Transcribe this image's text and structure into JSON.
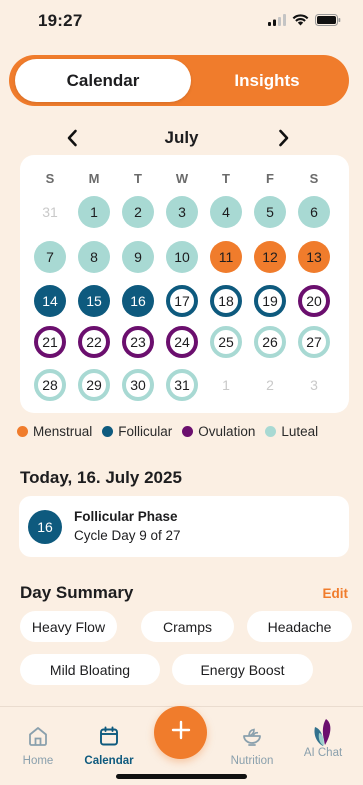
{
  "status": {
    "time": "19:27"
  },
  "segment": {
    "calendar_label": "Calendar",
    "insights_label": "Insights",
    "selected": "Calendar"
  },
  "month": {
    "label": "July"
  },
  "weekdays": [
    "S",
    "M",
    "T",
    "W",
    "T",
    "F",
    "S"
  ],
  "days": [
    {
      "label": "31",
      "state": "faded"
    },
    {
      "label": "1",
      "state": "luteal"
    },
    {
      "label": "2",
      "state": "luteal"
    },
    {
      "label": "3",
      "state": "luteal"
    },
    {
      "label": "4",
      "state": "luteal"
    },
    {
      "label": "5",
      "state": "luteal"
    },
    {
      "label": "6",
      "state": "luteal"
    },
    {
      "label": "7",
      "state": "luteal"
    },
    {
      "label": "8",
      "state": "luteal"
    },
    {
      "label": "9",
      "state": "luteal"
    },
    {
      "label": "10",
      "state": "luteal"
    },
    {
      "label": "11",
      "state": "menstrual"
    },
    {
      "label": "12",
      "state": "menstrual"
    },
    {
      "label": "13",
      "state": "menstrual"
    },
    {
      "label": "14",
      "state": "follicular"
    },
    {
      "label": "15",
      "state": "follicular"
    },
    {
      "label": "16",
      "state": "follicular"
    },
    {
      "label": "17",
      "state": "ring-follicular"
    },
    {
      "label": "18",
      "state": "ring-follicular"
    },
    {
      "label": "19",
      "state": "ring-follicular"
    },
    {
      "label": "20",
      "state": "ring-ovulation"
    },
    {
      "label": "21",
      "state": "ring-ovulation"
    },
    {
      "label": "22",
      "state": "ring-ovulation"
    },
    {
      "label": "23",
      "state": "ring-ovulation"
    },
    {
      "label": "24",
      "state": "ring-ovulation"
    },
    {
      "label": "25",
      "state": "ring-luteal"
    },
    {
      "label": "26",
      "state": "ring-luteal"
    },
    {
      "label": "27",
      "state": "ring-luteal"
    },
    {
      "label": "28",
      "state": "ring-luteal"
    },
    {
      "label": "29",
      "state": "ring-luteal"
    },
    {
      "label": "30",
      "state": "ring-luteal"
    },
    {
      "label": "31",
      "state": "ring-luteal"
    },
    {
      "label": "1",
      "state": "faded"
    },
    {
      "label": "2",
      "state": "faded"
    },
    {
      "label": "3",
      "state": "faded"
    }
  ],
  "legend": [
    {
      "label": "Menstrual",
      "color": "#f07c2c"
    },
    {
      "label": "Follicular",
      "color": "#0e5a7e"
    },
    {
      "label": "Ovulation",
      "color": "#6b0f6e"
    },
    {
      "label": "Luteal",
      "color": "#a8d9d3"
    }
  ],
  "today": {
    "title": "Today, 16. July 2025",
    "day_number": "16",
    "phase": "Follicular Phase",
    "cycle_day": "Cycle Day 9 of 27"
  },
  "summary": {
    "title": "Day Summary",
    "edit_label": "Edit",
    "chips": [
      "Heavy Flow",
      "Cramps",
      "Headache",
      "Mild Bloating",
      "Energy Boost"
    ]
  },
  "tabbar": {
    "tabs": [
      {
        "label": "Home",
        "icon": "home-icon"
      },
      {
        "label": "Calendar",
        "icon": "calendar-icon",
        "active": true
      },
      {
        "label": "Nutrition",
        "icon": "nutrition-bowl-icon"
      },
      {
        "label": "AI Chat",
        "icon": "ai-chat-logo-icon"
      }
    ],
    "fab_icon": "plus-icon"
  },
  "colors": {
    "accent": "#f07c2c",
    "follicular": "#0e5a7e",
    "ovulation": "#6b0f6e",
    "luteal": "#a8d9d3",
    "background": "#fbefe3"
  }
}
